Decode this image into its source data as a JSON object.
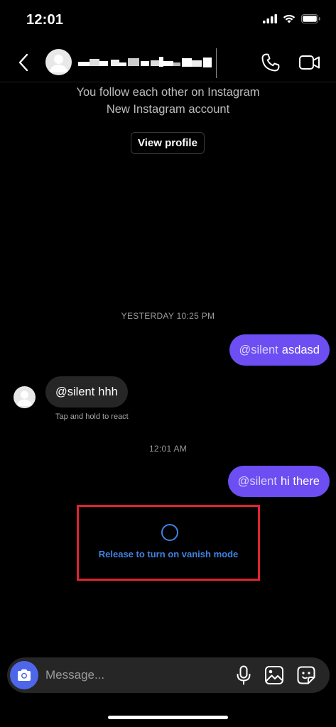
{
  "status_bar": {
    "time": "12:01"
  },
  "header": {
    "back_icon": "chevron-left-icon",
    "call_icon": "phone-icon",
    "video_icon": "video-camera-icon"
  },
  "profile": {
    "line1": "You follow each other on Instagram",
    "line2": "New Instagram account",
    "view_profile_label": "View profile"
  },
  "messages": [
    {
      "type": "timestamp",
      "text": "YESTERDAY 10:25 PM"
    },
    {
      "type": "outgoing",
      "mention": "@silent",
      "text": "asdasd"
    },
    {
      "type": "incoming",
      "mention": "@silent",
      "text": "hhh",
      "hint": "Tap and hold to react"
    },
    {
      "type": "timestamp",
      "text": "12:01 AM"
    },
    {
      "type": "outgoing",
      "mention": "@silent",
      "text": "hi there"
    }
  ],
  "vanish": {
    "label": "Release to turn on vanish mode"
  },
  "composer": {
    "placeholder": "Message..."
  },
  "colors": {
    "outgoing_bubble": "#6c4ef2",
    "incoming_bubble": "#262626",
    "vanish_accent": "#3f84e0",
    "highlight_box": "#e0242f",
    "camera_button": "#4e67ea"
  }
}
